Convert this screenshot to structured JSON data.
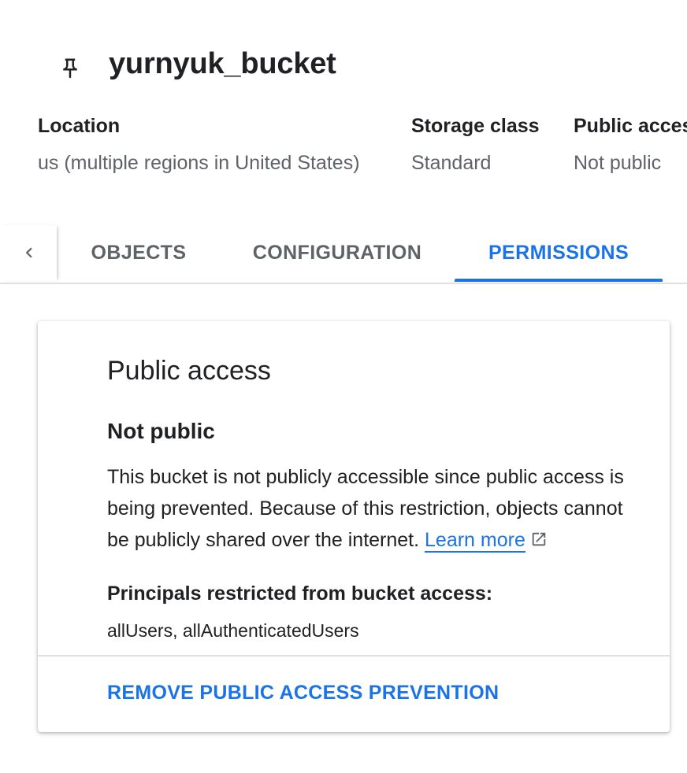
{
  "header": {
    "title": "yurnyuk_bucket",
    "icon": "pin-icon"
  },
  "meta": {
    "location_label": "Location",
    "location_value": "us (multiple regions in United States)",
    "storage_label": "Storage class",
    "storage_value": "Standard",
    "public_label": "Public access",
    "public_value": "Not public"
  },
  "tabs": {
    "scroll_icon": "chevron-left-icon",
    "items": [
      {
        "label": "OBJECTS",
        "active": false
      },
      {
        "label": "CONFIGURATION",
        "active": false
      },
      {
        "label": "PERMISSIONS",
        "active": true
      }
    ]
  },
  "card": {
    "title": "Public access",
    "status_title": "Not public",
    "description": "This bucket is not publicly accessible since public access is being prevented. Because of this restriction, objects cannot be publicly shared over the internet.",
    "learn_more": "Learn more",
    "external_icon": "open-in-new-icon",
    "principals_label": "Principals restricted from bucket access:",
    "principals_value": "allUsers, allAuthenticatedUsers",
    "remove_button": "REMOVE PUBLIC ACCESS PREVENTION"
  },
  "colors": {
    "accent": "#1a73e8",
    "text_primary": "#202124",
    "text_secondary": "#5f6368",
    "divider": "#e0e0e0"
  }
}
